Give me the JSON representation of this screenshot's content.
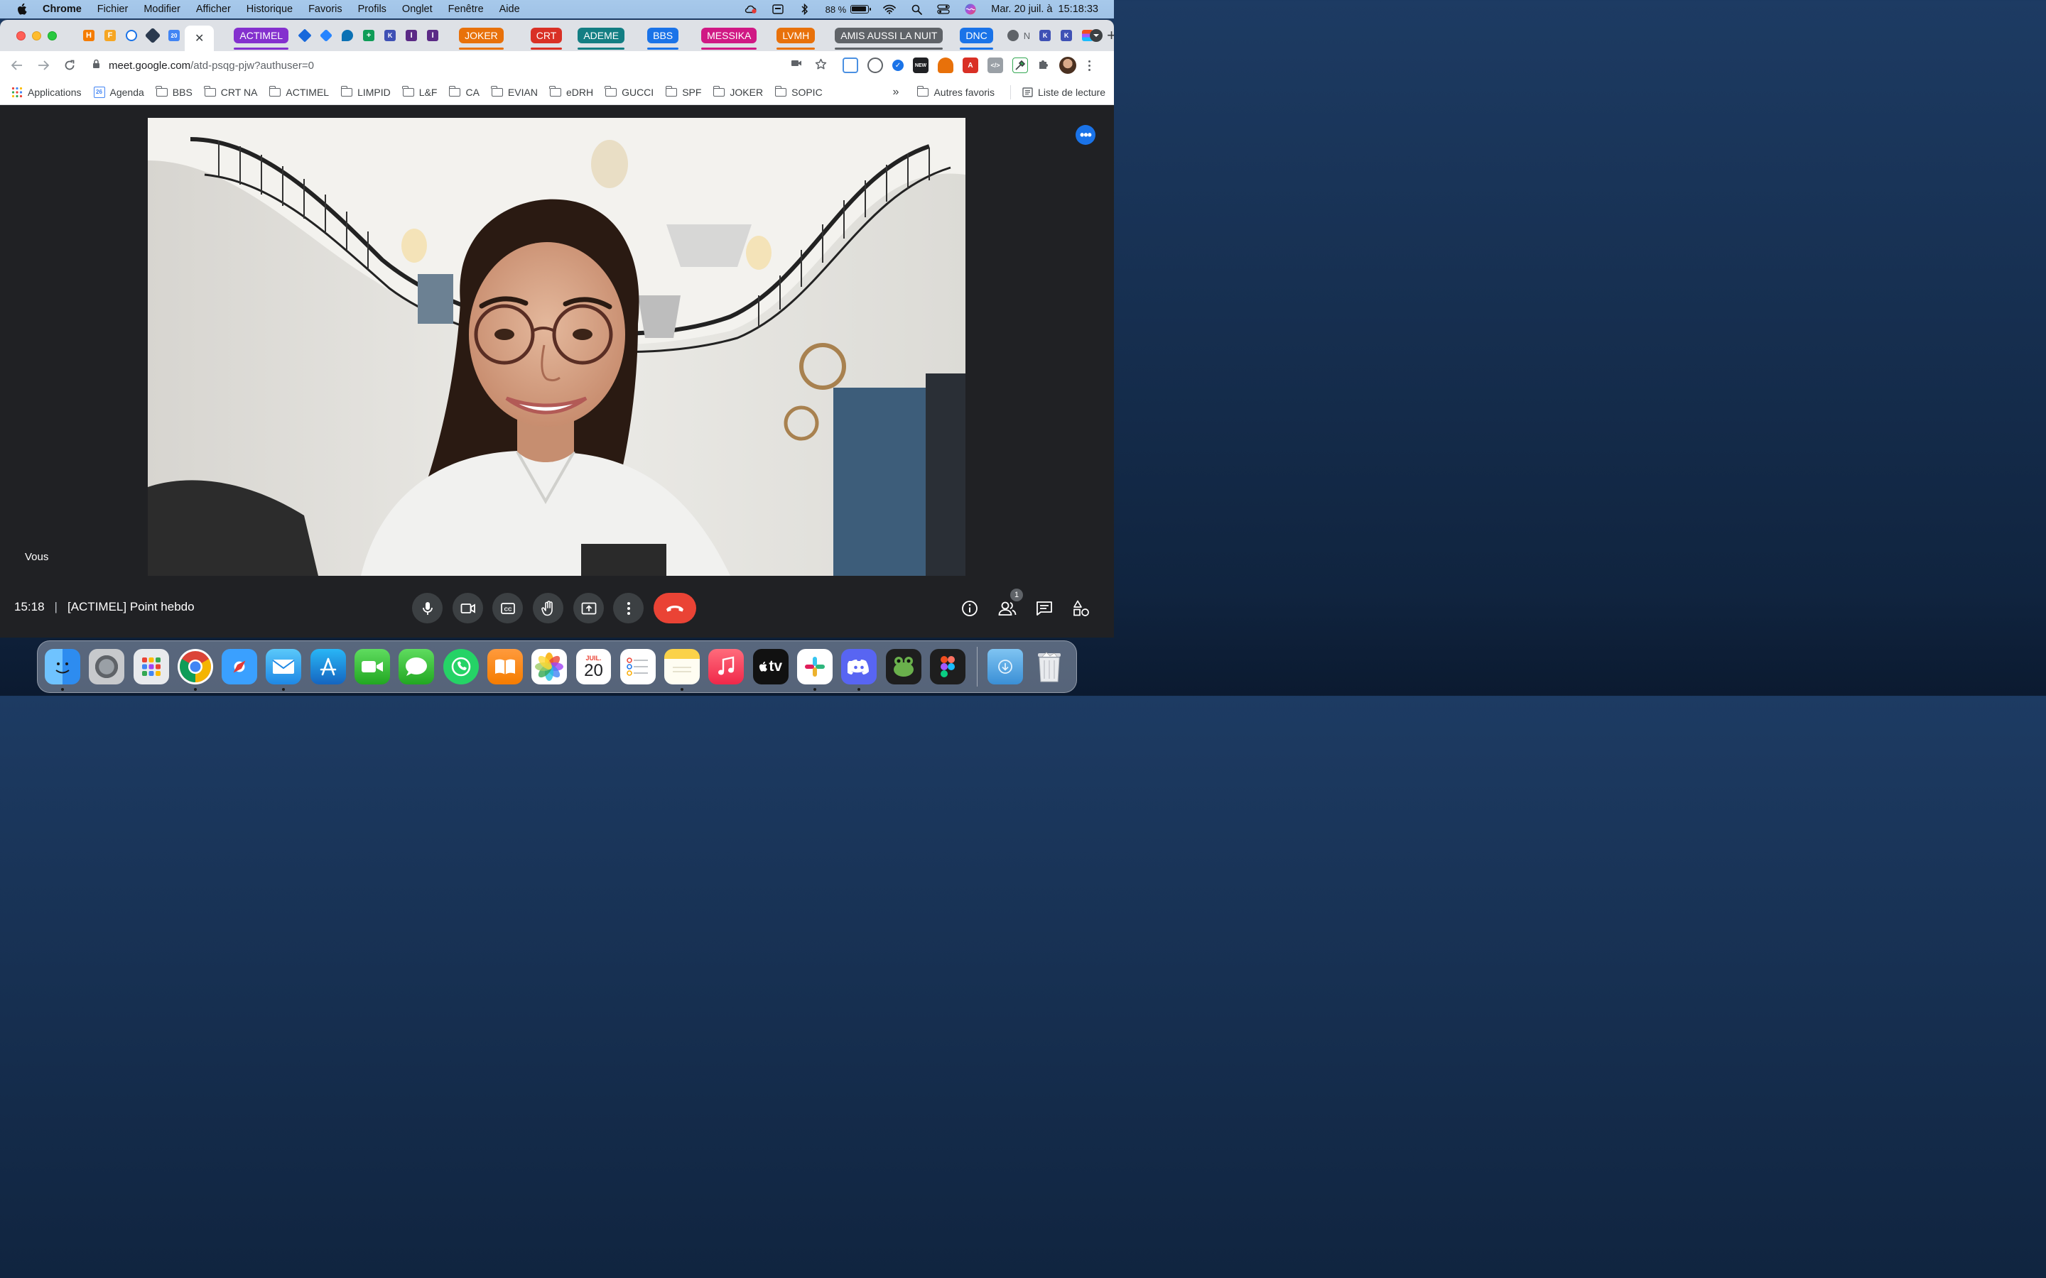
{
  "menubar": {
    "app_name": "Chrome",
    "items": [
      "Fichier",
      "Modifier",
      "Afficher",
      "Historique",
      "Favoris",
      "Profils",
      "Onglet",
      "Fenêtre",
      "Aide"
    ],
    "battery": "88 %",
    "datetime": "Mar. 20 juil. à  15:18:33"
  },
  "tabs": {
    "group_chips": [
      {
        "label": "ACTIMEL",
        "color": "#8430ce"
      },
      {
        "label": "JOKER",
        "color": "#e8710a"
      },
      {
        "label": "CRT",
        "color": "#d93025"
      },
      {
        "label": "ADEME",
        "color": "#137e83"
      },
      {
        "label": "BBS",
        "color": "#1a73e8"
      },
      {
        "label": "MESSIKA",
        "color": "#d01884"
      },
      {
        "label": "LVMH",
        "color": "#e8710a"
      },
      {
        "label": "AMIS AUSSI LA NUIT",
        "color": "#5f6368"
      },
      {
        "label": "DNC",
        "color": "#1a73e8"
      }
    ],
    "small_tab_text": "N"
  },
  "toolbar": {
    "url_host": "meet.google.com",
    "url_path": "/atd-psqg-pjw?authuser=0"
  },
  "bookmarks": {
    "apps_label": "Applications",
    "agenda_label": "Agenda",
    "agenda_day": "26",
    "folders": [
      "BBS",
      "CRT NA",
      "ACTIMEL",
      "LIMPID",
      "L&F",
      "CA",
      "EVIAN",
      "eDRH",
      "GUCCI",
      "SPF",
      "JOKER",
      "SOPIC"
    ],
    "overflow": "»",
    "other_label": "Autres favoris",
    "reading_list": "Liste de lecture"
  },
  "meet": {
    "self_label": "Vous",
    "time": "15:18",
    "separator": "|",
    "meeting_title": "[ACTIMEL] Point hebdo",
    "participants_count": "1",
    "accent_color": "#1a73e8",
    "end_call_color": "#ea4335"
  },
  "dock": {
    "calendar_month": "JUIL.",
    "calendar_day": "20",
    "tv_label": "tv"
  }
}
